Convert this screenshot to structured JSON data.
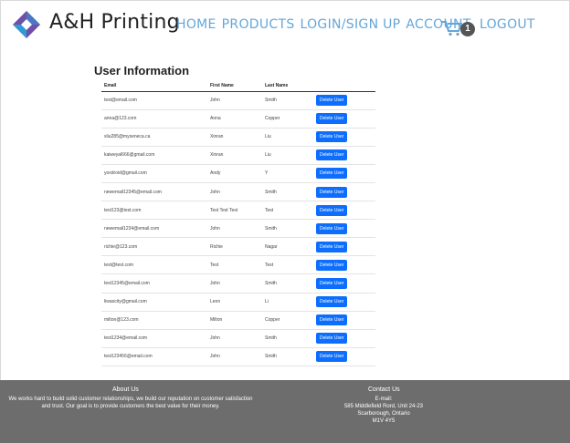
{
  "brand": {
    "name": "A&H Printing"
  },
  "nav": {
    "home": "HOME",
    "products": "PRODUCTS",
    "login": "LOGIN/SIGN UP",
    "account": "ACCOUNT",
    "cart_count": "1",
    "logout": "LOGOUT"
  },
  "page": {
    "title": "User Information"
  },
  "table": {
    "headers": [
      "Email",
      "First Name",
      "Last Name"
    ],
    "delete_label": "Delete User",
    "rows": [
      [
        "test@email.com",
        "John",
        "Smith"
      ],
      [
        "anna@123.com",
        "Anna",
        "Copper"
      ],
      [
        "xliu285@myseneca.ca",
        "Xinran",
        "Liu"
      ],
      [
        "kaiweyal666@gmail.com",
        "Xinran",
        "Liu"
      ],
      [
        "yoxdroid@gmail.com",
        "Andy",
        "Y"
      ],
      [
        "newemail12345@email.com",
        "John",
        "Smith"
      ],
      [
        "test123@test.com",
        "Test Test Test",
        "Test"
      ],
      [
        "newemail1234@email.com",
        "John",
        "Smith"
      ],
      [
        "richie@123.com",
        "Richie",
        "Nagar"
      ],
      [
        "test@test.com",
        "Test",
        "Test"
      ],
      [
        "test12345@email.com",
        "John",
        "Smith"
      ],
      [
        "liwaocity@gmail.com",
        "Leon",
        "Li"
      ],
      [
        "milton@123.com",
        "Milton",
        "Copper"
      ],
      [
        "test1234@email.com",
        "John",
        "Smith"
      ],
      [
        "test123456@email.com",
        "John",
        "Smith"
      ]
    ]
  },
  "footer": {
    "about_title": "About Us",
    "about_text": "We works hard to build solid customer relationships, we build our reputation on customer satisfaction and trust. Our goal is to provide customers the best value for their money.",
    "contact_title": "Contact Us",
    "contact_email_label": "E-mail:",
    "contact_address1": "585 Middlefield Rord, Unit 24-23",
    "contact_address2": "Scarborough, Ontario",
    "contact_postal": "M1V 4Y5"
  },
  "colors": {
    "nav": "#64a6d8",
    "button": "#0d6efd",
    "footer": "#6d6d6d"
  }
}
